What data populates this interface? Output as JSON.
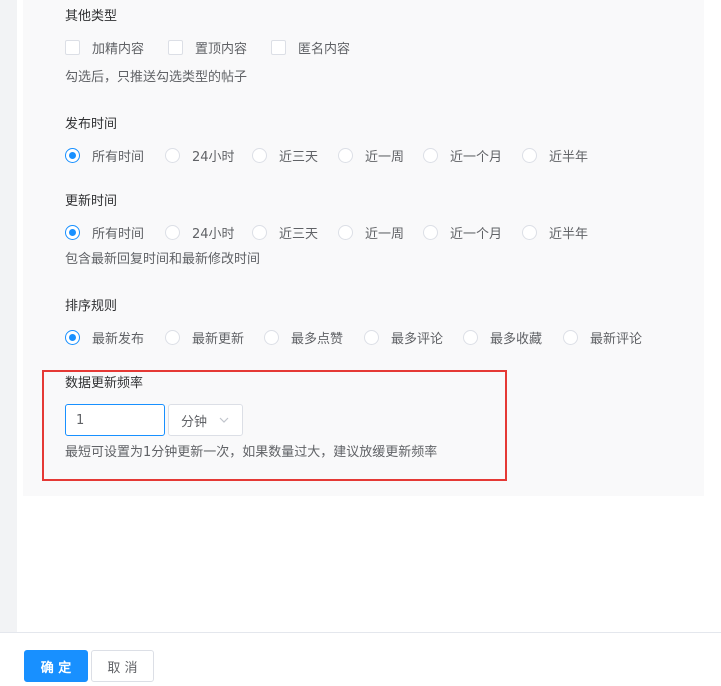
{
  "other_types": {
    "label": "其他类型",
    "options": [
      "加精内容",
      "置顶内容",
      "匿名内容"
    ],
    "hint": "勾选后，只推送勾选类型的帖子"
  },
  "publish_time": {
    "label": "发布时间",
    "options": [
      "所有时间",
      "24小时",
      "近三天",
      "近一周",
      "近一个月",
      "近半年"
    ],
    "selected": "所有时间"
  },
  "update_time": {
    "label": "更新时间",
    "options": [
      "所有时间",
      "24小时",
      "近三天",
      "近一周",
      "近一个月",
      "近半年"
    ],
    "selected": "所有时间",
    "hint": "包含最新回复时间和最新修改时间"
  },
  "sort_rule": {
    "label": "排序规则",
    "options": [
      "最新发布",
      "最新更新",
      "最多点赞",
      "最多评论",
      "最多收藏",
      "最新评论"
    ],
    "selected": "最新发布"
  },
  "refresh_rate": {
    "label": "数据更新频率",
    "value": "1",
    "unit": "分钟",
    "hint": "最短可设置为1分钟更新一次，如果数量过大，建议放缓更新频率"
  },
  "footer": {
    "confirm_label": "确 定",
    "cancel_label": "取 消"
  },
  "colors": {
    "accent": "#1890ff",
    "highlight_border": "#e53935"
  }
}
